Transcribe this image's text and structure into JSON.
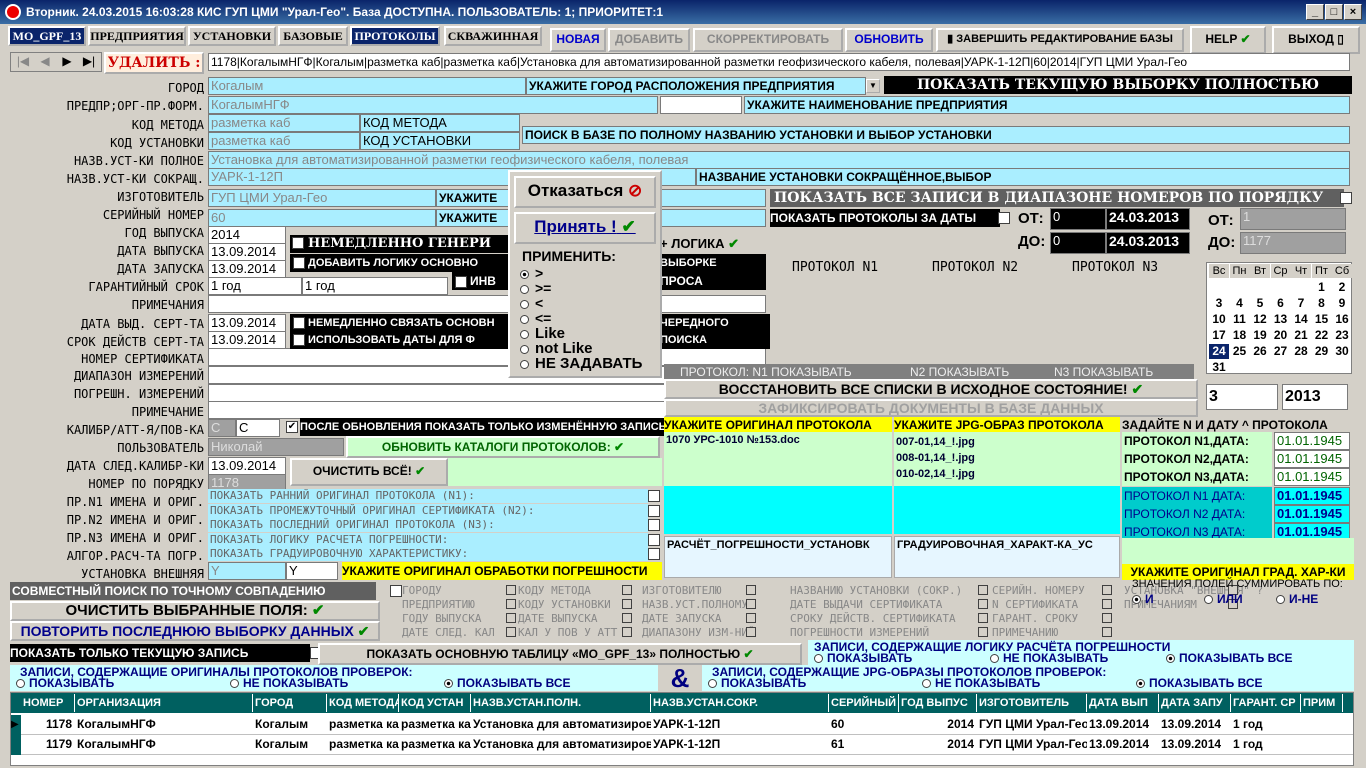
{
  "window": {
    "title": "Вторник. 24.03.2015 16:03:28 КИС ГУП ЦМИ \"Урал-Гео\". База ДОСТУПНА. ПОЛЬЗОВАТЕЛЬ: 1; ПРИОРИТЕТ:1"
  },
  "tabs": [
    "MO_GPF_13",
    "ПРЕДПРИЯТИЯ",
    "УСТАНОВКИ",
    "БАЗОВЫЕ",
    "ПРОТОКОЛЫ",
    "СКВАЖИННАЯ"
  ],
  "toolbar": {
    "new": "НОВАЯ",
    "add": "ДОБАВИТЬ",
    "correct": "СКОРРЕКТИРОВАТЬ",
    "refresh": "ОБНОВИТЬ",
    "finish": "ЗАВЕРШИТЬ РЕДАКТИРОВАНИЕ БАЗЫ",
    "help": "HELP",
    "exit": "ВЫХОД"
  },
  "delete_label": "УДАЛИТЬ :",
  "record_line": "1178|КогалымНГФ|Когалым|разметка каб|разметка каб|Установка для автоматизированной разметки геофизического кабеля, полевая|УАРК-1-12П|60|2014|ГУП ЦМИ Урал-Гео",
  "labels": [
    "ГОРОД",
    "ПРЕДПР;ОРГ-ПР.ФОРМ.",
    "КОД МЕТОДА",
    "КОД УСТАНОВКИ",
    "НАЗВ.УСТ-КИ ПОЛНОЕ",
    "НАЗВ.УСТ-КИ СОКРАЩ.",
    "ИЗГОТОВИТЕЛЬ",
    "СЕРИЙНЫЙ НОМЕР",
    "ГОД ВЫПУСКА",
    "ДАТА ВЫПУСКА",
    "ДАТА ЗАПУСКА",
    "ГАРАНТИЙНЫЙ СРОК",
    "ПРИМЕЧАНИЯ",
    "ДАТА ВЫД. СЕРТ-ТА",
    "СРОК ДЕЙСТВ СЕРТ-ТА",
    "НОМЕР СЕРТИФИКАТА",
    "ДИАПАЗОН ИЗМЕРЕНИЙ",
    "ПОГРЕШН. ИЗМЕРЕНИЙ",
    "ПРИМЕЧАНИЕ",
    "КАЛИБР/АТТ-Я/ПОВ-КА",
    "ПОЛЬЗОВАТЕЛЬ",
    "ДАТА СЛЕД.КАЛИБР-КИ",
    "НОМЕР ПО ПОРЯДКУ",
    "ПР.N1 ИМЕНА И ОРИГ.",
    "ПР.N2 ИМЕНА И ОРИГ.",
    "ПР.N3 ИМЕНА И ОРИГ.",
    "АЛГОР.РАСЧ-ТА ПОГР.",
    "УСТАНОВКА ВНЕШНЯЯ"
  ],
  "fields": {
    "city": "Когалым",
    "org": "КогалымНГФ",
    "method": "разметка каб",
    "method_dd": "КОД МЕТОДА",
    "install": "разметка каб",
    "install_dd": "КОД УСТАНОВКИ",
    "full_name": "Установка для автоматизированной разметки геофизического кабеля, полевая",
    "short_name": "УАРК-1-12П",
    "maker": "ГУП ЦМИ Урал-Гео",
    "serial": "60",
    "year": "2014",
    "release": "13.09.2014",
    "start": "13.09.2014",
    "warranty": "1 год",
    "warranty_dd": "1 год",
    "cert_date": "13.09.2014",
    "cert_term": "13.09.2014",
    "calib": "C",
    "calib_dd": "C",
    "user": "Николай",
    "next_calib": "13.09.2014",
    "order": "1178",
    "ext": "Y",
    "ext_dd": "Y"
  },
  "hints": {
    "city": "УКАЖИТЕ ГОРОД РАСПОЛОЖЕНИЯ ПРЕДПРИЯТИЯ",
    "org": "УКАЖИТЕ НАИМЕНОВАНИЕ ПРЕДПРИЯТИЯ",
    "search": "ПОИСК В БАЗЕ ПО ПОЛНОМУ НАЗВАНИЮ УСТАНОВКИ И ВЫБОР УСТАНОВКИ",
    "short": "НАЗВАНИЕ УСТАНОВКИ СОКРАЩЁННОЕ,ВЫБОР",
    "maker": "УКАЖИТЕ",
    "serial": "УКАЖИТЕ",
    "show_all": "ПОКАЗАТЬ ТЕКУЩУЮ ВЫБОРКУ ПОЛНОСТЬЮ",
    "range": "ПОКАЗАТЬ ВСЕ ЗАПИСИ В ДИАПАЗОНЕ НОМЕРОВ ПО ПОРЯДКУ",
    "proto_dates": "ПОКАЗАТЬ ПРОТОКОЛЫ ЗА ДАТЫ"
  },
  "dialog": {
    "cancel": "Отказаться",
    "accept": "Принять !",
    "apply": "ПРИМЕНИТЬ:",
    "options": [
      ">",
      ">=",
      "<",
      "<=",
      "Like",
      "not Like",
      "НЕ ЗАДАВАТЬ"
    ]
  },
  "checks": {
    "gen": "НЕМЕДЛЕННО ГЕНЕРИ",
    "logic": "+ ЛОГИКА",
    "addlogic": "ДОБАВИТЬ ЛОГИКУ ОСНОВНО",
    "vyborke": "ВЫБОРКЕ",
    "inv": "ИНВ",
    "prosa": "ПРОСА",
    "link": "НЕМЕДЛЕННО СВЯЗАТЬ ОСНОВН",
    "ocher": "ЧЕРЕДНОГО",
    "usedates": "ИСПОЛЬЗОВАТЬ ДАТЫ ДЛЯ Ф",
    "poisk": "ПОИСКА",
    "after": "ПОСЛЕ ОБНОВЛЕНИЯ ПОКАЗАТЬ ТОЛЬКО ИЗМЕНЁННУЮ ЗАПИСЬ"
  },
  "range": {
    "from_lbl": "ОТ:",
    "to_lbl": "ДО:",
    "from_n": "0",
    "to_n": "0",
    "from_d": "24.03.2013",
    "to_d": "24.03.2013",
    "from2": "1",
    "to2": "1177"
  },
  "protocols": {
    "p1": "ПРОТОКОЛ N1",
    "p2": "ПРОТОКОЛ N2",
    "p3": "ПРОТОКОЛ N3",
    "s1": "ПРОТОКОЛ: N1 ПОКАЗЫВАТЬ",
    "s2": "N2 ПОКАЗЫВАТЬ",
    "s3": "N3 ПОКАЗЫВАТЬ",
    "restore": "ВОССТАНОВИТЬ ВСЕ СПИСКИ В ИСХОДНОЕ СОСТОЯНИЕ!",
    "fix": "ЗАФИКСИРОВАТЬ ДОКУМЕНТЫ В БАЗЕ ДАННЫХ"
  },
  "calendar": {
    "days": [
      "Вс",
      "Пн",
      "Вт",
      "Ср",
      "Чт",
      "Пт",
      "Сб"
    ],
    "weeks": [
      [
        "",
        "",
        "",
        "",
        "",
        "1",
        "2"
      ],
      [
        "3",
        "4",
        "5",
        "6",
        "7",
        "8",
        "9"
      ],
      [
        "10",
        "11",
        "12",
        "13",
        "14",
        "15",
        "16"
      ],
      [
        "17",
        "18",
        "19",
        "20",
        "21",
        "22",
        "23"
      ],
      [
        "24",
        "25",
        "26",
        "27",
        "28",
        "29",
        "30"
      ],
      [
        "31",
        "",
        "",
        "",
        "",
        "",
        ""
      ]
    ],
    "month": "3",
    "year": "2013"
  },
  "docs": {
    "h1": "УКАЖИТЕ ОРИГИНАЛ ПРОТОКОЛА",
    "h2": "УКАЖИТЕ JPG-ОБРАЗ ПРОТОКОЛА",
    "h3": "ЗАДАЙТЕ N И ДАТУ ^ ПРОТОКОЛА",
    "doc1": "1070 УРС-1010 №153.doc",
    "jpg": [
      "007-01,14_!.jpg",
      "008-01,14_!.jpg",
      "010-02,14_!.jpg"
    ],
    "pl": [
      "ПРОТОКОЛ N1,ДАТА:",
      "ПРОТОКОЛ N2,ДАТА:",
      "ПРОТОКОЛ N3,ДАТА:"
    ],
    "pd": [
      "01.01.1945",
      "01.01.1945",
      "01.01.1945"
    ],
    "ql": [
      "ПРОТОКОЛ N1 ДАТА:",
      "ПРОТОКОЛ N2 ДАТА:",
      "ПРОТОКОЛ N3 ДАТА:"
    ],
    "qd": [
      "01.01.1945",
      "01.01.1945",
      "01.01.1945"
    ],
    "calc": "РАСЧЁТ_ПОГРЕШНОСТИ_УСТАНОВК",
    "grad": "ГРАДУИРОВОЧНАЯ_ХАРАКТ-КА_УС",
    "grad_hint": "УКАЖИТЕ ОРИГИНАЛ ГРАД. ХАР-КИ",
    "alg_hint": "УКАЖИТЕ ОРИГИНАЛ ОБРАБОТКИ ПОГРЕШНОСТИ"
  },
  "mid": {
    "update_cat": "ОБНОВИТЬ КАТАЛОГИ ПРОТОКОЛОВ:",
    "clear_all": "ОЧИСТИТЬ ВСЁ!",
    "rows": [
      "ПОКАЗАТЬ РАННИЙ ОРИГИНАЛ ПРОТОКОЛА (N1):",
      "ПОКАЗАТЬ ПРОМЕЖУТОЧНЫЙ ОРИГИНАЛ СЕРТИФИКАТА (N2):",
      "ПОКАЗАТЬ ПОСЛЕДНИЙ ОРИГИНАЛ ПРОТОКОЛА (N3):",
      "ПОКАЗАТЬ ЛОГИКУ РАСЧЕТА ПОГРЕШНОСТИ:",
      "ПОКАЗАТЬ ГРАДУИРОВОЧНУЮ ХАРАКТЕРИСТИКУ:"
    ]
  },
  "bottom": {
    "joint": "СОВМЕСТНЫЙ ПОИСК ПО ТОЧНОМУ СОВПАДЕНИЮ",
    "clear_sel": "ОЧИСТИТЬ ВЫБРАННЫЕ ПОЛЯ:",
    "repeat": "ПОВТОРИТЬ ПОСЛЕДНЮЮ ВЫБОРКУ ДАННЫХ",
    "only_cur": "ПОКАЗАТЬ ТОЛЬКО ТЕКУЩУЮ ЗАПИСЬ",
    "show_main": "ПОКАЗАТЬ ОСНОВНУЮ ТАБЛИЦУ «MO_GPF_13» ПОЛНОСТЬЮ",
    "grey": [
      [
        "ГОРОДУ",
        "ПРЕДПРИЯТИЮ",
        "ГОДУ ВЫПУСКА",
        "ДАТЕ СЛЕД. КАЛ"
      ],
      [
        "КОДУ МЕТОДА",
        "КОДУ УСТАНОВКИ",
        "ДАТЕ ВЫПУСКА",
        "КАЛ У ПОВ У АТТ"
      ],
      [
        "ИЗГОТОВИТЕЛЮ",
        "НАЗВ.УСТ.ПОЛНОМУ",
        "ДАТЕ ЗАПУСКА",
        "ДИАПАЗОНУ ИЗМ-НИЙ"
      ],
      [
        "НАЗВАНИЮ УСТАНОВКИ (СОКР.)",
        "ДАТЕ ВЫДАЧИ СЕРТИФИКАТА",
        "СРОКУ ДЕЙСТВ. СЕРТИФИКАТА",
        "ПОГРЕШНОСТИ ИЗМЕРЕНИЙ"
      ],
      [
        "СЕРИЙН. НОМЕРУ",
        "N СЕРТИФИКАТА",
        "ГАРАНТ. СРОКУ",
        "ПРИМЕЧАНИЮ"
      ],
      [
        "УСТАНОВКА \"ВНЕШНЯЯ\" ?",
        "ПРИМЕЧАНИЯМ"
      ]
    ],
    "sum_title": "ЗНАЧЕНИЯ ПОЛЕЙ СУММИРОВАТЬ ПО:",
    "sum_opts": [
      "И",
      "ИЛИ",
      "И-НЕ"
    ],
    "logic_title": "ЗАПИСИ, СОДЕРЖАЩИЕ ЛОГИКУ РАСЧЁТА ПОГРЕШНОСТИ",
    "logic_opts": [
      "ПОКАЗЫВАТЬ",
      "НЕ ПОКАЗЫВАТЬ",
      "ПОКАЗЫВАТЬ ВСЕ"
    ],
    "orig_title": "ЗАПИСИ, СОДЕРЖАЩИЕ ОРИГИНАЛЫ ПРОТОКОЛОВ ПРОВЕРОК:",
    "jpg_title": "ЗАПИСИ, СОДЕРЖАЩИЕ JPG-ОБРАЗЫ ПРОТОКОЛОВ ПРОВЕРОК:",
    "opts": [
      "ПОКАЗЫВАТЬ",
      "НЕ ПОКАЗЫВАТЬ",
      "ПОКАЗЫВАТЬ ВСЕ"
    ],
    "amp": "&"
  },
  "table": {
    "headers": [
      "НОМЕР",
      "ОРГАНИЗАЦИЯ",
      "ГОРОД",
      "КОД МЕТОДА",
      "КОД УСТАН",
      "НАЗВ.УСТАН.ПОЛН.",
      "НАЗВ.УСТАН.СОКР.",
      "СЕРИЙНЫЙ",
      "ГОД ВЫПУС",
      "ИЗГОТОВИТЕЛЬ",
      "ДАТА ВЫП",
      "ДАТА ЗАПУ",
      "ГАРАНТ. СР",
      "ПРИМ"
    ],
    "rows": [
      [
        "1178",
        "КогалымНГФ",
        "Когалым",
        "разметка ка",
        "разметка ка",
        "Установка для автоматизиров",
        "УАРК-1-12П",
        "60",
        "2014",
        "ГУП ЦМИ Урал-Гео",
        "13.09.2014",
        "13.09.2014",
        "1 год",
        ""
      ],
      [
        "1179",
        "КогалымНГФ",
        "Когалым",
        "разметка ка",
        "разметка ка",
        "Установка для автоматизиров",
        "УАРК-1-12П",
        "61",
        "2014",
        "ГУП ЦМИ Урал-Гео",
        "13.09.2014",
        "13.09.2014",
        "1 год",
        ""
      ]
    ]
  }
}
